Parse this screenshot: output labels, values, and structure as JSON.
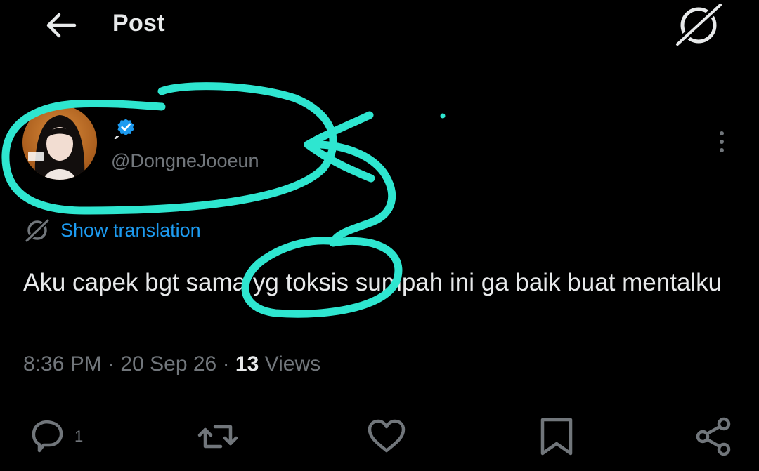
{
  "header": {
    "title": "Post",
    "back_icon": "arrow-left-icon",
    "grok_icon": "grok-icon"
  },
  "author": {
    "display_name": "ˏ",
    "handle": "@DongneJooeun",
    "verified_color": "#1d9bf0"
  },
  "translation": {
    "label": "Show translation"
  },
  "post": {
    "text": "Aku capek bgt sama yg toksis sumpah ini ga baik buat mentalku"
  },
  "meta": {
    "time": "8:36 PM",
    "separator": "·",
    "date": "20 Sep 26",
    "views_count": "13",
    "views_label": "Views"
  },
  "actions": {
    "reply_count": "1",
    "icons": [
      "reply-icon",
      "repost-icon",
      "like-icon",
      "bookmark-icon",
      "share-icon"
    ]
  },
  "colors": {
    "background": "#000000",
    "text": "#e7e9ea",
    "muted": "#71767b",
    "accent": "#1d9bf0",
    "annotation": "#2ee6d0"
  }
}
